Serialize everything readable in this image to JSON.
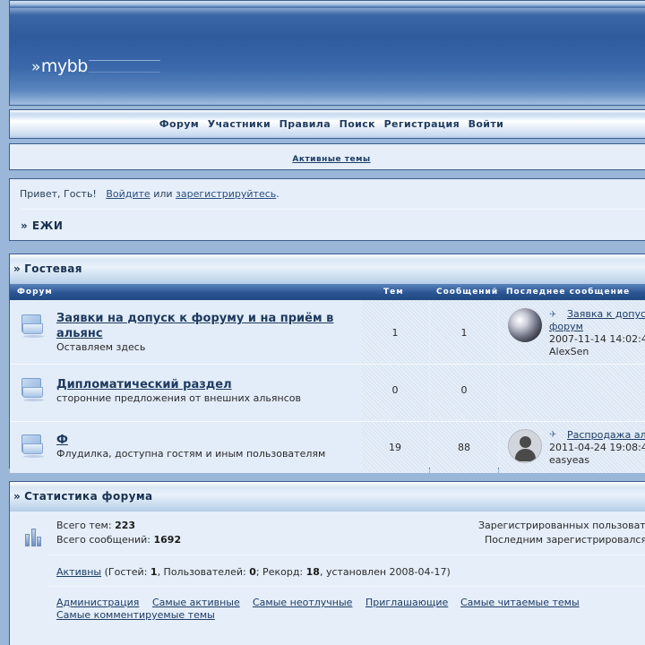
{
  "header": {
    "logo": "mybb"
  },
  "nav": {
    "items": [
      "Форум",
      "Участники",
      "Правила",
      "Поиск",
      "Регистрация",
      "Войти"
    ]
  },
  "active_topics": "Активные темы",
  "welcome": {
    "greeting": "Привет, Гость!",
    "login": "Войдите",
    "or": "или",
    "register": "зарегистрируйтесь",
    "end": "."
  },
  "breadcrumb": "» ЕЖИ",
  "category": {
    "title": "Гостевая",
    "columns": {
      "forum": "Форум",
      "topics": "Тем",
      "posts": "Сообщений",
      "last": "Последнее сообщение"
    },
    "forums": [
      {
        "title_line1": "Заявки на допуск к форуму и на приём в",
        "title_line2": "альянс",
        "desc": "Оставляем здесь",
        "topics": "1",
        "posts": "1",
        "last_link_line1": "Заявка к допус",
        "last_link_line2": "форум",
        "last_date": "2007-11-14 14:02:4",
        "last_user": "AlexSen"
      },
      {
        "title_line1": "Дипломатический раздел",
        "desc": "сторонние предложения от внешних альянсов",
        "topics": "0",
        "posts": "0"
      },
      {
        "title_line1": "Ф",
        "desc": "Флудилка, доступна гостям и иным пользователям",
        "topics": "19",
        "posts": "88",
        "last_link_line1": "Распродажа ал",
        "last_date": "2011-04-24 19:08:4",
        "last_user": "easyeas"
      }
    ]
  },
  "stats": {
    "title": "Статистика форума",
    "topics_label": "Всего тем:",
    "topics_value": "223",
    "posts_label": "Всего сообщений:",
    "posts_value": "1692",
    "registered": "Зарегистрированных пользоват",
    "last_registered": "Последним зарегистрировался",
    "active_link": "Активны",
    "guests_label": " (Гостей: ",
    "guests_value": "1",
    "users_label": ", Пользователей: ",
    "users_value": "0",
    "record_label": "; Рекорд: ",
    "record_value": "18",
    "record_date": ", установлен 2008-04-17)",
    "links": [
      "Администрация",
      "Самые активные",
      "Самые неотлучные",
      "Приглашающие",
      "Самые читаемые темы",
      "Самые комментируемые темы"
    ]
  }
}
